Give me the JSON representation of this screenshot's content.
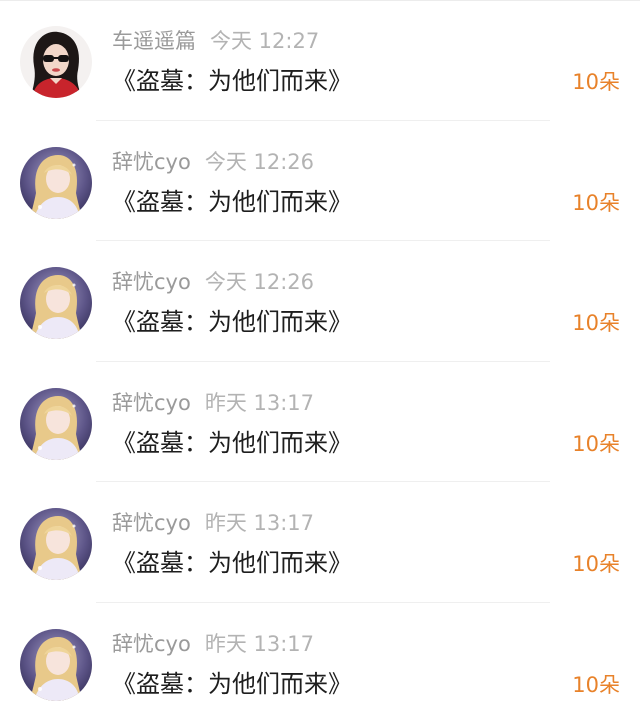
{
  "colors": {
    "username": "#9a9a9a",
    "time": "#b3b3b3",
    "message": "#1e1e1e",
    "count": "#e8822a",
    "divider": "#efefef"
  },
  "gift_list": [
    {
      "avatar": "woman-sunglasses-avatar",
      "username": "车遥遥篇",
      "time": "今天 12:27",
      "message": "《盗墓：为他们而来》",
      "count": "10朵"
    },
    {
      "avatar": "anime-girl-avatar",
      "username": "辞忧cyo",
      "time": "今天 12:26",
      "message": "《盗墓：为他们而来》",
      "count": "10朵"
    },
    {
      "avatar": "anime-girl-avatar",
      "username": "辞忧cyo",
      "time": "今天 12:26",
      "message": "《盗墓：为他们而来》",
      "count": "10朵"
    },
    {
      "avatar": "anime-girl-avatar",
      "username": "辞忧cyo",
      "time": "昨天 13:17",
      "message": "《盗墓：为他们而来》",
      "count": "10朵"
    },
    {
      "avatar": "anime-girl-avatar",
      "username": "辞忧cyo",
      "time": "昨天 13:17",
      "message": "《盗墓：为他们而来》",
      "count": "10朵"
    },
    {
      "avatar": "anime-girl-avatar",
      "username": "辞忧cyo",
      "time": "昨天 13:17",
      "message": "《盗墓：为他们而来》",
      "count": "10朵"
    }
  ]
}
